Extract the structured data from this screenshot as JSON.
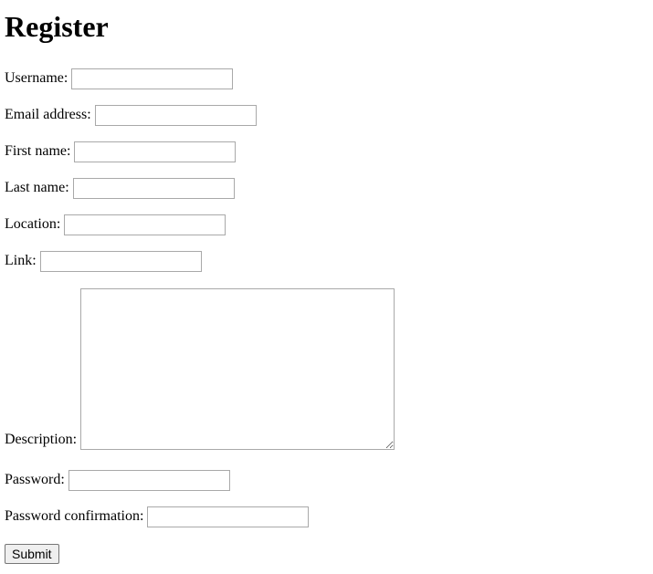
{
  "page": {
    "title": "Register"
  },
  "form": {
    "fields": {
      "username": {
        "label": "Username:",
        "value": ""
      },
      "email": {
        "label": "Email address:",
        "value": ""
      },
      "first_name": {
        "label": "First name:",
        "value": ""
      },
      "last_name": {
        "label": "Last name:",
        "value": ""
      },
      "location": {
        "label": "Location:",
        "value": ""
      },
      "link": {
        "label": "Link:",
        "value": ""
      },
      "description": {
        "label": "Description:",
        "value": ""
      },
      "password": {
        "label": "Password:",
        "value": ""
      },
      "password_confirmation": {
        "label": "Password confirmation:",
        "value": ""
      }
    },
    "submit_label": "Submit"
  }
}
